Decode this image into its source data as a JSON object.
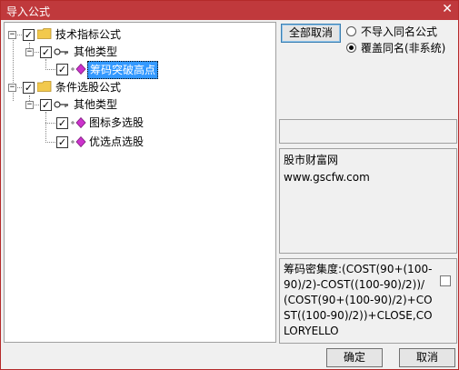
{
  "window": {
    "title": "导入公式",
    "close_glyph": "✕"
  },
  "tree": {
    "nodes": [
      {
        "label": "技术指标公式",
        "toggle": "−",
        "checked": "✓"
      },
      {
        "label": "其他类型",
        "toggle": "−",
        "checked": "✓"
      },
      {
        "label": "筹码突破高点",
        "checked": "✓",
        "selected": true
      },
      {
        "label": "条件选股公式",
        "toggle": "−",
        "checked": "✓"
      },
      {
        "label": "其他类型",
        "toggle": "−",
        "checked": "✓"
      },
      {
        "label": "图标多选股",
        "checked": "✓"
      },
      {
        "label": "优选点选股",
        "checked": "✓"
      }
    ]
  },
  "options": {
    "cancel_all_label": "全部取消",
    "radio_no_import": "不导入同名公式",
    "radio_overwrite": "覆盖同名(非系统)"
  },
  "info": {
    "line1": "股市财富网",
    "line2": "www.gscfw.com"
  },
  "formula": {
    "text": "筹码密集度:(COST(90+(100-90)/2)-COST((100-90)/2))/(COST(90+(100-90)/2)+COST((100-90)/2))+CLOSE,COLORYELLO"
  },
  "buttons": {
    "ok_label": "确定",
    "cancel_label": "取消"
  },
  "colors": {
    "titlebar": "#c0393c",
    "selection": "#3399ff",
    "folder": "#f2c94c",
    "diamond": "#cc33cc"
  }
}
